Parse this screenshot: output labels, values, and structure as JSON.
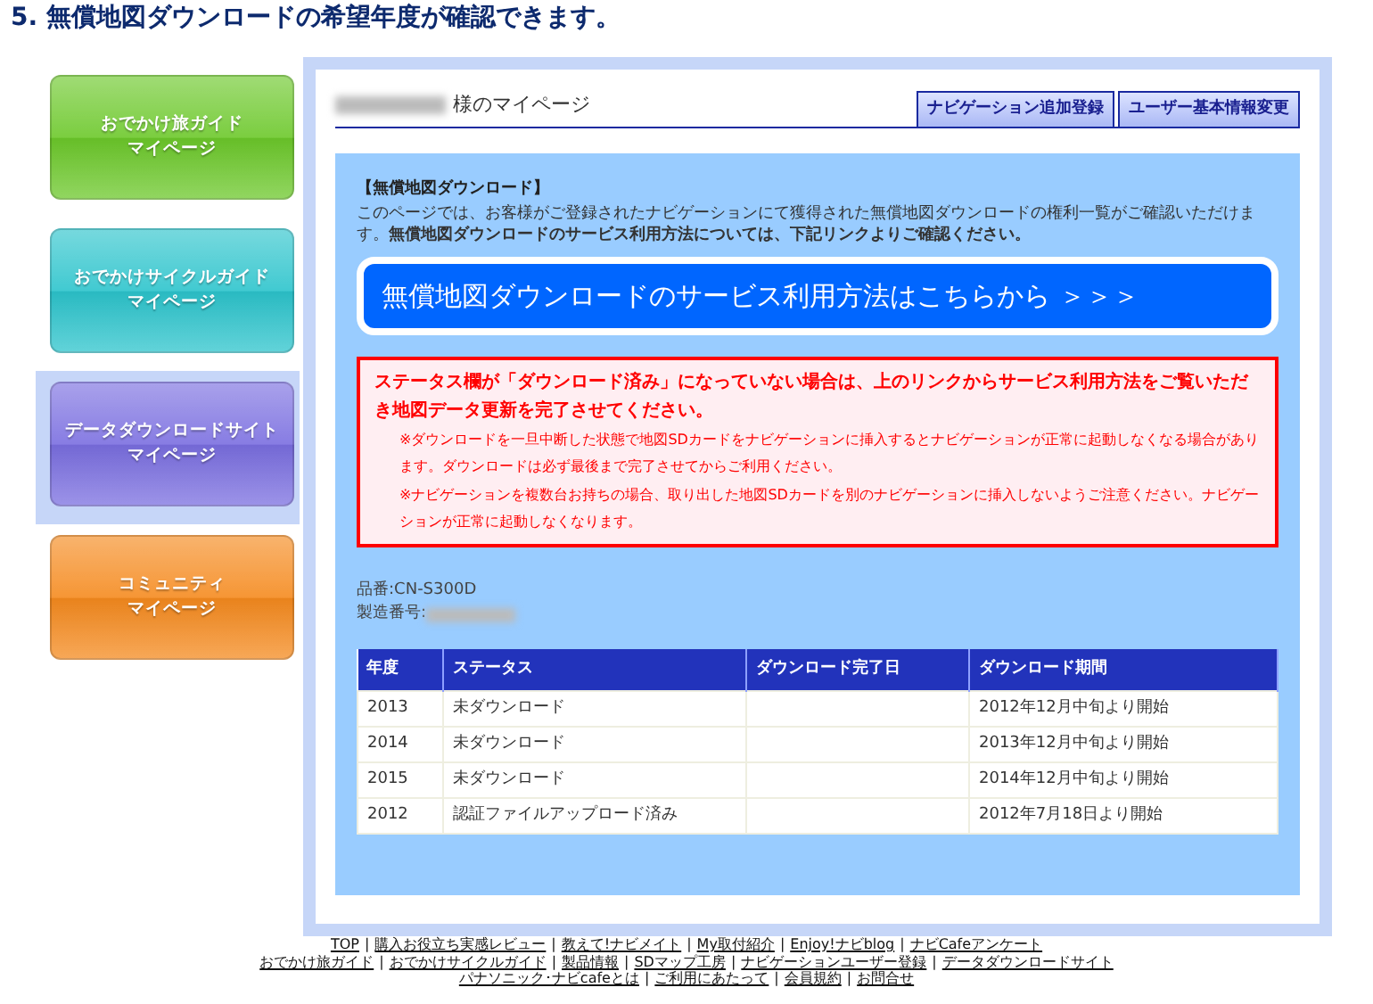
{
  "heading": "5. 無償地図ダウンロードの希望年度が確認できます。",
  "sidebar": {
    "items": [
      {
        "label": "おでかけ旅ガイド",
        "sub": "マイページ",
        "color": "#6cc82a",
        "selected": false
      },
      {
        "label": "おでかけサイクルガイド",
        "sub": "マイページ",
        "color": "#2cc4cc",
        "selected": false
      },
      {
        "label": "データダウンロードサイト",
        "sub": "マイページ",
        "color": "#7a6ee0",
        "selected": true
      },
      {
        "label": "コミュニティ",
        "sub": "マイページ",
        "color": "#f58a1e",
        "selected": false
      }
    ]
  },
  "header": {
    "title": "様のマイページ",
    "tabs": [
      "ナビゲーション追加登録",
      "ユーザー基本情報変更"
    ]
  },
  "section_title": "【無償地図ダウンロード】",
  "intro": "このページでは、お客様がご登録されたナビゲーションにて獲得された無償地図ダウンロードの権利一覧がご確認いただけます。**無償地図ダウンロードのサービス利用方法については、下記リンクよりご確認ください。**",
  "banner": "無償地図ダウンロードのサービス利用方法はこちらから ＞＞＞",
  "notice": {
    "headline": "ステータス欄が「ダウンロード済み」になっていない場合は、上のリンクからサービス利用方法をご覧いただき地図データ更新を完了させてください。",
    "notes": [
      "※ダウンロードを一旦中断した状態で地図SDカードをナビゲーションに挿入するとナビゲーションが正常に起動しなくなる場合があります。ダウンロードは必ず最後まで完了させてからご利用ください。",
      "※ナビゲーションを複数台お持ちの場合、取り出した地図SDカードを別のナビゲーションに挿入しないようご注意ください。ナビゲーションが正常に起動しなくなります。"
    ]
  },
  "product": {
    "model_label": "品番:",
    "model": "CN-S300D",
    "serial_label": "製造番号:"
  },
  "table": {
    "columns": [
      "年度",
      "ステータス",
      "ダウンロード完了日",
      "ダウンロード期間"
    ],
    "rows": [
      [
        "2013",
        "未ダウンロード",
        "",
        "2012年12月中旬より開始"
      ],
      [
        "2014",
        "未ダウンロード",
        "",
        "2013年12月中旬より開始"
      ],
      [
        "2015",
        "未ダウンロード",
        "",
        "2014年12月中旬より開始"
      ],
      [
        "2012",
        "認証ファイルアップロード済み",
        "",
        "2012年7月18日より開始"
      ]
    ]
  },
  "footer": {
    "separator": "|",
    "lines": [
      [
        "TOP",
        "購入お役立ち実感レビュー",
        "教えて!ナビメイト",
        "My取付紹介",
        "Enjoy!ナビblog",
        "ナビCafeアンケート"
      ],
      [
        "おでかけ旅ガイド",
        "おでかけサイクルガイド",
        "製品情報",
        "SDマップ工房",
        "ナビゲーションユーザー登録",
        "データダウンロードサイト"
      ],
      [
        "パナソニック･ナビcafeとは",
        "ご利用にあたって",
        "会員規約",
        "お問合せ"
      ]
    ]
  }
}
